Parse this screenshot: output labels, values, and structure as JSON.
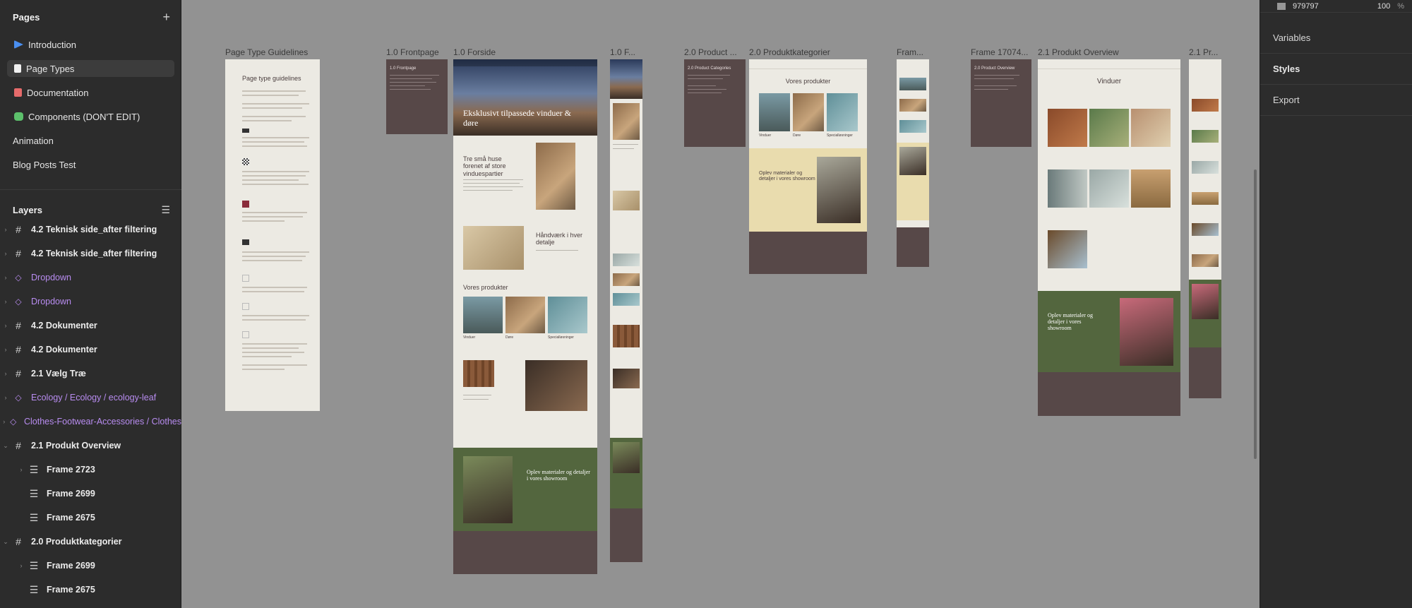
{
  "left_panel": {
    "pages_header": "Pages",
    "add_page_symbol": "+",
    "pages": [
      {
        "label": "Introduction",
        "icon": "play-icon",
        "selected": false
      },
      {
        "label": "Page Types",
        "icon": "document-icon",
        "selected": true
      },
      {
        "label": "Documentation",
        "icon": "book-icon",
        "selected": false
      },
      {
        "label": "Components (DON'T EDIT)",
        "icon": "puzzle-icon",
        "selected": false
      },
      {
        "label": "Animation",
        "icon": "",
        "selected": false
      },
      {
        "label": "Blog Posts Test",
        "icon": "",
        "selected": false
      }
    ],
    "layers_header": "Layers",
    "layers": [
      {
        "label": "4.2 Teknisk side_after filtering",
        "type": "frame"
      },
      {
        "label": "4.2 Teknisk side_after filtering",
        "type": "frame"
      },
      {
        "label": "Dropdown",
        "type": "component"
      },
      {
        "label": "Dropdown",
        "type": "component"
      },
      {
        "label": "4.2 Dokumenter",
        "type": "frame"
      },
      {
        "label": "4.2 Dokumenter",
        "type": "frame"
      },
      {
        "label": "2.1 Vælg Træ",
        "type": "frame"
      },
      {
        "label": "Ecology / Ecology / ecology-leaf",
        "type": "component"
      },
      {
        "label": "Clothes-Footwear-Accessories / Clothes",
        "type": "component"
      },
      {
        "label": "2.1 Produkt Overview",
        "type": "frame"
      },
      {
        "label": "Frame 2723",
        "type": "child"
      },
      {
        "label": "Frame 2699",
        "type": "child"
      },
      {
        "label": "Frame 2675",
        "type": "child"
      },
      {
        "label": "2.0 Produktkategorier",
        "type": "frame"
      },
      {
        "label": "Frame 2699",
        "type": "child"
      },
      {
        "label": "Frame 2675",
        "type": "child"
      }
    ]
  },
  "right_panel": {
    "fill_hex": "979797",
    "opacity": "100",
    "percent_symbol": "%",
    "sections": [
      "Variables",
      "Styles",
      "Export"
    ]
  },
  "canvas": {
    "frames": [
      {
        "label": "Page Type Guidelines"
      },
      {
        "label": "1.0 Frontpage"
      },
      {
        "label": "1.0 Forside"
      },
      {
        "label": "1.0 F..."
      },
      {
        "label": "2.0 Product ..."
      },
      {
        "label": "2.0 Produktkategorier"
      },
      {
        "label": "Fram..."
      },
      {
        "label": "Frame 17074..."
      },
      {
        "label": "2.1 Produkt Overview"
      },
      {
        "label": "2.1 Pr..."
      }
    ],
    "guidelines_title": "Page type guidelines",
    "note_frontpage": "1.0 Frontpage",
    "note_product_categories": "2.0 Product Categories",
    "note_product_overview": "2.0 Product Overview",
    "forside_hero": "Eksklusivt tilpassede vinduer & døre",
    "forside_intro": "Tre små huse forenet af store vinduespartier",
    "forside_craft": "Håndværk i hver detalje",
    "forside_products": "Vores produkter",
    "forside_showroom": "Oplev materialer og detaljer i vores showroom",
    "kategorier_title": "Vores produkter",
    "kategorier_showroom": "Oplev materialer og detaljer i vores showroom",
    "overview_title": "Vinduer",
    "overview_showroom": "Oplev materialer og detaljer i vores showroom",
    "product_labels": [
      "Vinduer",
      "Døre",
      "Specialløsninger"
    ]
  }
}
